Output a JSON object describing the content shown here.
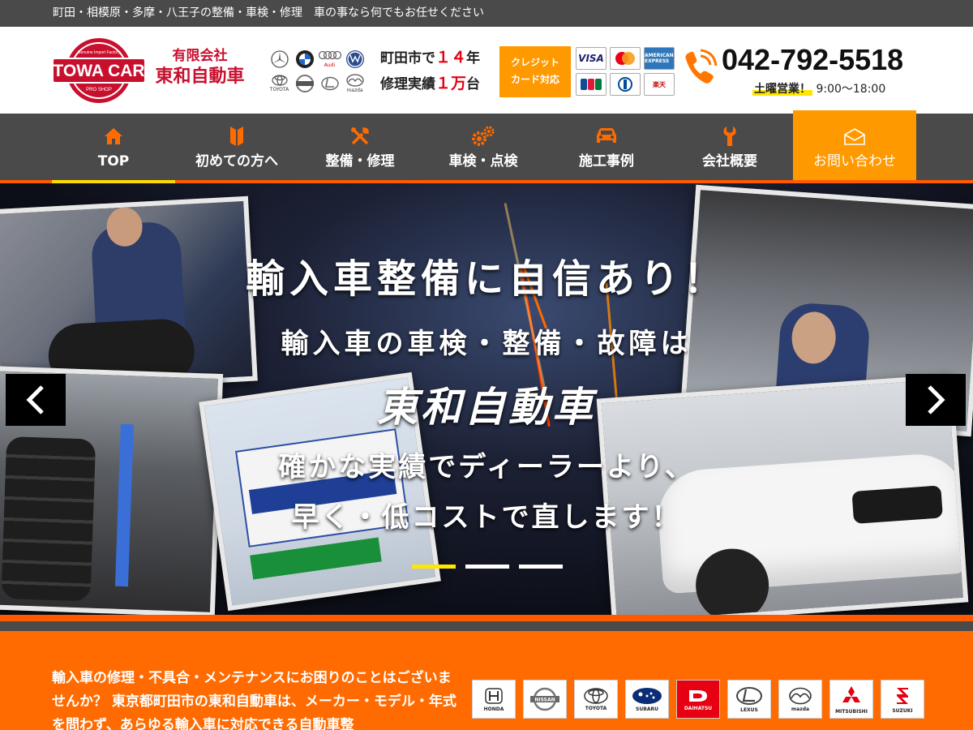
{
  "topbar": {
    "text": "町田・相模原・多摩・八王子の整備・車検・修理　車の事なら何でもお任せください"
  },
  "header": {
    "logo": {
      "main": "TOWA CAR",
      "arc": "Genuine Import Factory",
      "sub": "PRO SHOP"
    },
    "company_kind": "有限会社",
    "company_name": "東和自動車",
    "brands": [
      {
        "name": "Mercedes-Benz",
        "icon": "mercedes-logo"
      },
      {
        "name": "BMW",
        "icon": "bmw-logo"
      },
      {
        "name": "Audi",
        "icon": "audi-logo"
      },
      {
        "name": "VW",
        "icon": "vw-logo"
      },
      {
        "name": "TOYOTA",
        "icon": "toyota-logo"
      },
      {
        "name": "NISSAN",
        "icon": "nissan-logo"
      },
      {
        "name": "LEXUS",
        "icon": "lexus-logo"
      },
      {
        "name": "mazda",
        "icon": "mazda-logo"
      }
    ],
    "record_line1_a": "町田市で",
    "record_line1_num": "１４",
    "record_line1_b": "年",
    "record_line2_a": "修理実績",
    "record_line2_num": "１万",
    "record_line2_b": "台",
    "credit_line1": "クレジット",
    "credit_line2": "カード対応",
    "cards": [
      "VISA",
      "MasterCard",
      "AMERICAN EXPRESS",
      "JCB",
      "Diners Club",
      "楽天"
    ],
    "phone": "042-792-5518",
    "hours_label": "土曜営業！",
    "hours_time": "9:00〜18:00"
  },
  "nav": [
    {
      "label": "TOP",
      "icon": "home-icon",
      "active": true
    },
    {
      "label": "初めての方へ",
      "icon": "beginner-mark-icon"
    },
    {
      "label": "整備・修理",
      "icon": "tools-icon"
    },
    {
      "label": "車検・点検",
      "icon": "gears-icon"
    },
    {
      "label": "施工事例",
      "icon": "car-icon"
    },
    {
      "label": "会社概要",
      "icon": "wrench-icon"
    },
    {
      "label": "お問い合わせ",
      "icon": "mail-icon"
    }
  ],
  "hero": {
    "line1": "輸入車整備に自信あり！",
    "line2": "輸入車の車検・整備・故障は",
    "line3": "東和自動車",
    "line4": "確かな実績でディーラーより、",
    "line5": "早く・低コストで直します！",
    "slides": 3,
    "active_slide": 1
  },
  "intro": {
    "text": "輸入車の修理・不具合・メンテナンスにお困りのことはございませんか？ 東京都町田市の東和自動車は、メーカー・モデル・年式を問わず、あらゆる輸入車に対応できる自動車整",
    "makers": [
      "HONDA",
      "NISSAN",
      "TOYOTA",
      "SUBARU",
      "DAIHATSU",
      "LEXUS",
      "mazda",
      "MITSUBISHI",
      "SUZUKI"
    ]
  },
  "colors": {
    "accent": "#ff6b00",
    "nav_bg": "#4a4a4a",
    "brand_red": "#c8102e",
    "highlight": "#ffe600"
  }
}
